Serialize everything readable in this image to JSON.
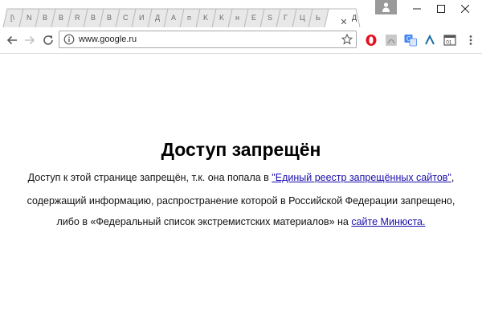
{
  "browser": {
    "tabs": [
      {
        "label": "[\\"
      },
      {
        "label": "N"
      },
      {
        "label": "B"
      },
      {
        "label": "B"
      },
      {
        "label": "R"
      },
      {
        "label": "B"
      },
      {
        "label": "B"
      },
      {
        "label": "C"
      },
      {
        "label": "И"
      },
      {
        "label": "Д"
      },
      {
        "label": "A"
      },
      {
        "label": "п"
      },
      {
        "label": "K"
      },
      {
        "label": "K"
      },
      {
        "label": "н"
      },
      {
        "label": "E"
      },
      {
        "label": "S"
      },
      {
        "label": "Г"
      },
      {
        "label": "Ц"
      },
      {
        "label": "Ь"
      },
      {
        "label": "Д",
        "active": true
      }
    ],
    "close_tab_glyph": "✕",
    "url": "www.google.ru",
    "window_controls": {
      "minimize": "—",
      "maximize": "☐",
      "close": "✕"
    }
  },
  "page": {
    "title": "Доступ запрещён",
    "line1_text": "Доступ к этой странице запрещён, т.к. она попала в ",
    "line1_link": "\"Единый реестр запрещённых сайтов\"",
    "line1_end": ",",
    "line2_text": "содержащий информацию, распространение которой в Российской Федерации запрещено,",
    "line3_text": "либо в «Федеральный список экстремистских материалов» на ",
    "line3_link": "сайте Минюста."
  },
  "colors": {
    "link": "#1a0dab",
    "opera_red": "#e3101f",
    "translate_blue": "#4285f4"
  }
}
